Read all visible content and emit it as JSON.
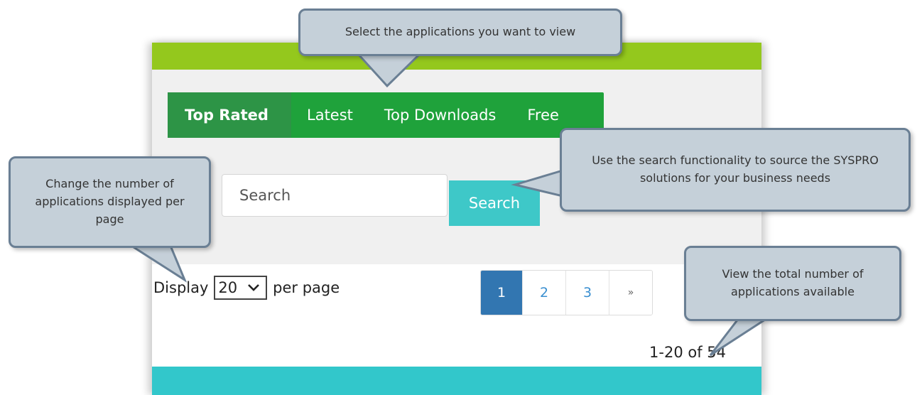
{
  "tabs": [
    {
      "label": "Top Rated",
      "active": true
    },
    {
      "label": "Latest",
      "active": false
    },
    {
      "label": "Top Downloads",
      "active": false
    },
    {
      "label": "Free",
      "active": false
    }
  ],
  "search": {
    "placeholder": "Search",
    "button_label": "Search"
  },
  "display": {
    "prefix": "Display",
    "selected": "20",
    "suffix": "per page"
  },
  "pagination": {
    "pages": [
      "1",
      "2",
      "3"
    ],
    "active": "1",
    "next": "»"
  },
  "result_count": "1-20 of 54",
  "colors": {
    "topbar": "#94c81d",
    "tabs_bg": "#1fa23b",
    "search_button": "#3ec8c8",
    "footer": "#32c7cb",
    "active_page": "#3276b1",
    "callout_bg": "#c5d0d9"
  },
  "callouts": {
    "tabs": "Select the applications you want to view",
    "search": "Use the search functionality to source the SYSPRO solutions for your business needs",
    "display": "Change the number of applications displayed per page",
    "total": "View the total number of applications available"
  }
}
